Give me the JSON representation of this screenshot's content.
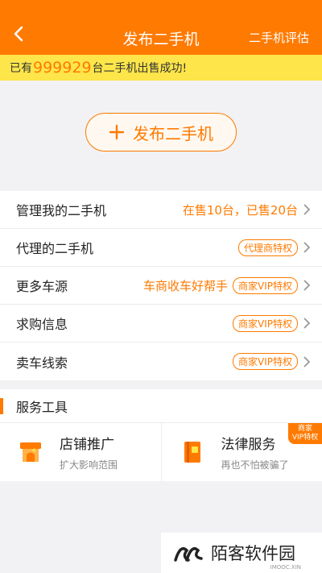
{
  "header": {
    "title": "发布二手机",
    "right": "二手机评估"
  },
  "notice": {
    "prefix": "已有",
    "count": "999929",
    "suffix": "台二手机出售成功!"
  },
  "publish": {
    "label": "发布二手机"
  },
  "list": [
    {
      "label": "管理我的二手机",
      "extra": "在售10台，已售20台",
      "badge": null
    },
    {
      "label": "代理的二手机",
      "extra": null,
      "badge": "代理商特权"
    },
    {
      "label": "更多车源",
      "extra": "车商收车好帮手",
      "badge": "商家VIP特权"
    },
    {
      "label": "求购信息",
      "extra": null,
      "badge": "商家VIP特权"
    },
    {
      "label": "卖车线索",
      "extra": null,
      "badge": "商家VIP特权"
    }
  ],
  "tools": {
    "heading": "服务工具",
    "items": [
      {
        "title": "店铺推广",
        "sub": "扩大影响范围",
        "icon": "shop-icon"
      },
      {
        "title": "法律服务",
        "sub": "再也不怕被骗了",
        "icon": "law-book-icon",
        "tag_line1": "商家",
        "tag_line2": "VIP特权"
      }
    ]
  },
  "watermark": {
    "name": "陌客软件园",
    "sub": "IMOOC.XIN"
  },
  "colors": {
    "accent": "#ff7a00",
    "notice_bg": "#fde54a"
  }
}
